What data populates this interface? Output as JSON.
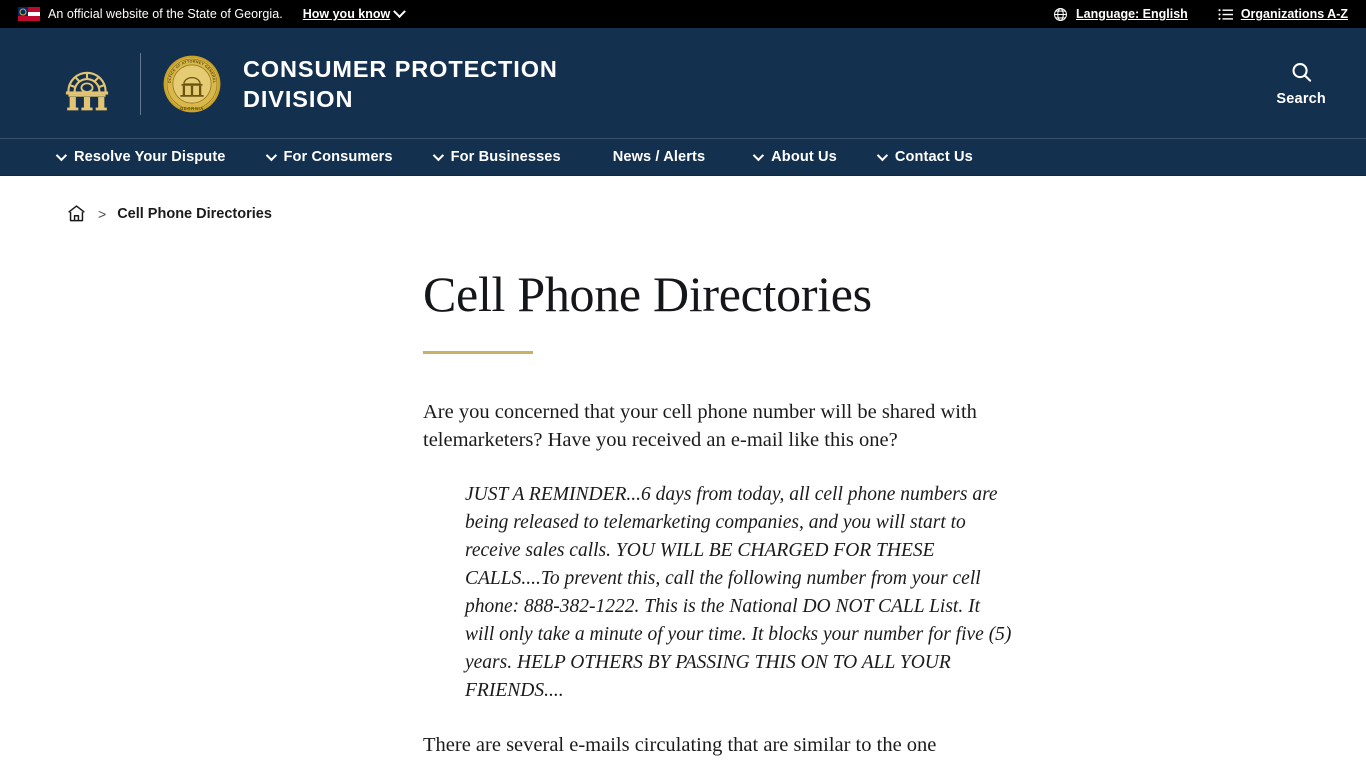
{
  "gov_banner": {
    "flag_icon": "georgia-state-flag-icon",
    "text": "An official website of the State of Georgia.",
    "how_you_know": "How you know",
    "language": {
      "icon": "globe-icon",
      "label": "Language: English"
    },
    "organizations": {
      "icon": "list-icon",
      "label": "Organizations A-Z"
    }
  },
  "header": {
    "arch_logo": "georgia-capitol-arch-logo",
    "seal": "office-of-attorney-general-georgia-seal",
    "seal_text_outer": "OFFICE OF ATTORNEY GENERAL",
    "seal_text_bottom": "GEORGIA",
    "site_title": "CONSUMER PROTECTION DIVISION",
    "search": {
      "icon": "search-icon",
      "label": "Search"
    },
    "background_color": "#14304f"
  },
  "nav": {
    "items": [
      {
        "label": "Resolve Your Dispute",
        "has_dropdown": true
      },
      {
        "label": "For Consumers",
        "has_dropdown": true
      },
      {
        "label": "For Businesses",
        "has_dropdown": true
      },
      {
        "label": "News / Alerts",
        "has_dropdown": false
      },
      {
        "label": "About Us",
        "has_dropdown": true
      },
      {
        "label": "Contact Us",
        "has_dropdown": true
      }
    ]
  },
  "breadcrumb": {
    "home_icon": "home-icon",
    "separator": ">",
    "current": "Cell Phone Directories"
  },
  "page": {
    "title": "Cell Phone Directories",
    "accent_color": "#c9b067",
    "intro": "Are you concerned that your cell phone number will be shared with telemarketers?  Have you received an e-mail like this one?",
    "quote": "JUST A REMINDER...6 days from today, all cell phone numbers are being released to telemarketing companies, and you will start to receive sales calls. YOU WILL BE CHARGED FOR THESE CALLS....To prevent this, call the following number from your cell phone: 888-382-1222.   This is the National DO NOT CALL List. It will only take a minute of your time. It blocks your number for five (5) years.  HELP OTHERS BY PASSING THIS ON TO ALL YOUR FRIENDS....",
    "after_quote": "There are several e-mails circulating that are similar to the one"
  }
}
